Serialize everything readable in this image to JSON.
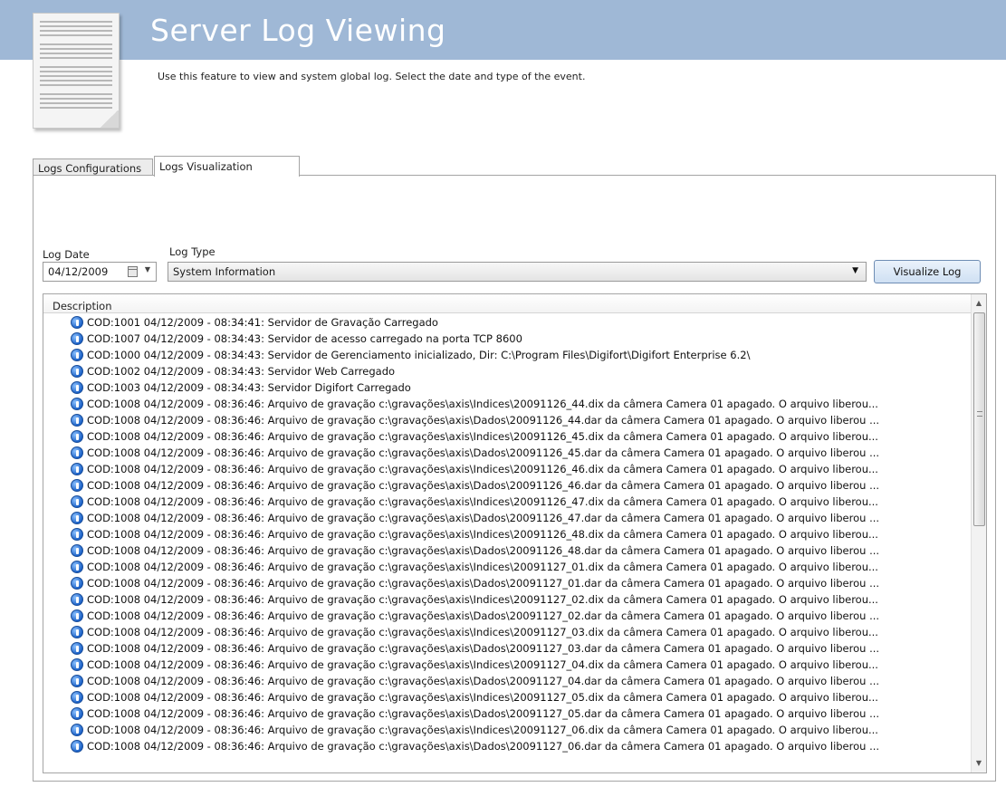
{
  "header": {
    "title": "Server Log Viewing",
    "description": "Use this feature to view and system global log. Select the date and type of the event."
  },
  "tabs": [
    {
      "label": "Logs Configurations",
      "active": false
    },
    {
      "label": "Logs Visualization",
      "active": true
    }
  ],
  "filters": {
    "date_label": "Log Date",
    "date_value": "04/12/2009",
    "type_label": "Log Type",
    "type_value": "System Information",
    "visualize_label": "Visualize Log"
  },
  "list": {
    "header": "Description",
    "icon": "info-icon",
    "rows": [
      "COD:1001 04/12/2009 - 08:34:41: Servidor de Gravação Carregado",
      "COD:1007 04/12/2009 - 08:34:43: Servidor de acesso carregado na porta TCP 8600",
      "COD:1000 04/12/2009 - 08:34:43: Servidor de Gerenciamento inicializado, Dir: C:\\Program Files\\Digifort\\Digifort Enterprise 6.2\\",
      "COD:1002 04/12/2009 - 08:34:43: Servidor Web Carregado",
      "COD:1003 04/12/2009 - 08:34:43: Servidor Digifort Carregado",
      "COD:1008 04/12/2009 - 08:36:46: Arquivo de gravação c:\\gravações\\axis\\Indices\\20091126_44.dix da câmera Camera 01 apagado. O arquivo liberou...",
      "COD:1008 04/12/2009 - 08:36:46: Arquivo de gravação c:\\gravações\\axis\\Dados\\20091126_44.dar da câmera Camera 01 apagado. O arquivo liberou ...",
      "COD:1008 04/12/2009 - 08:36:46: Arquivo de gravação c:\\gravações\\axis\\Indices\\20091126_45.dix da câmera Camera 01 apagado. O arquivo liberou...",
      "COD:1008 04/12/2009 - 08:36:46: Arquivo de gravação c:\\gravações\\axis\\Dados\\20091126_45.dar da câmera Camera 01 apagado. O arquivo liberou ...",
      "COD:1008 04/12/2009 - 08:36:46: Arquivo de gravação c:\\gravações\\axis\\Indices\\20091126_46.dix da câmera Camera 01 apagado. O arquivo liberou...",
      "COD:1008 04/12/2009 - 08:36:46: Arquivo de gravação c:\\gravações\\axis\\Dados\\20091126_46.dar da câmera Camera 01 apagado. O arquivo liberou ...",
      "COD:1008 04/12/2009 - 08:36:46: Arquivo de gravação c:\\gravações\\axis\\Indices\\20091126_47.dix da câmera Camera 01 apagado. O arquivo liberou...",
      "COD:1008 04/12/2009 - 08:36:46: Arquivo de gravação c:\\gravações\\axis\\Dados\\20091126_47.dar da câmera Camera 01 apagado. O arquivo liberou ...",
      "COD:1008 04/12/2009 - 08:36:46: Arquivo de gravação c:\\gravações\\axis\\Indices\\20091126_48.dix da câmera Camera 01 apagado. O arquivo liberou...",
      "COD:1008 04/12/2009 - 08:36:46: Arquivo de gravação c:\\gravações\\axis\\Dados\\20091126_48.dar da câmera Camera 01 apagado. O arquivo liberou ...",
      "COD:1008 04/12/2009 - 08:36:46: Arquivo de gravação c:\\gravações\\axis\\Indices\\20091127_01.dix da câmera Camera 01 apagado. O arquivo liberou...",
      "COD:1008 04/12/2009 - 08:36:46: Arquivo de gravação c:\\gravações\\axis\\Dados\\20091127_01.dar da câmera Camera 01 apagado. O arquivo liberou ...",
      "COD:1008 04/12/2009 - 08:36:46: Arquivo de gravação c:\\gravações\\axis\\Indices\\20091127_02.dix da câmera Camera 01 apagado. O arquivo liberou...",
      "COD:1008 04/12/2009 - 08:36:46: Arquivo de gravação c:\\gravações\\axis\\Dados\\20091127_02.dar da câmera Camera 01 apagado. O arquivo liberou ...",
      "COD:1008 04/12/2009 - 08:36:46: Arquivo de gravação c:\\gravações\\axis\\Indices\\20091127_03.dix da câmera Camera 01 apagado. O arquivo liberou...",
      "COD:1008 04/12/2009 - 08:36:46: Arquivo de gravação c:\\gravações\\axis\\Dados\\20091127_03.dar da câmera Camera 01 apagado. O arquivo liberou ...",
      "COD:1008 04/12/2009 - 08:36:46: Arquivo de gravação c:\\gravações\\axis\\Indices\\20091127_04.dix da câmera Camera 01 apagado. O arquivo liberou...",
      "COD:1008 04/12/2009 - 08:36:46: Arquivo de gravação c:\\gravações\\axis\\Dados\\20091127_04.dar da câmera Camera 01 apagado. O arquivo liberou ...",
      "COD:1008 04/12/2009 - 08:36:46: Arquivo de gravação c:\\gravações\\axis\\Indices\\20091127_05.dix da câmera Camera 01 apagado. O arquivo liberou...",
      "COD:1008 04/12/2009 - 08:36:46: Arquivo de gravação c:\\gravações\\axis\\Dados\\20091127_05.dar da câmera Camera 01 apagado. O arquivo liberou ...",
      "COD:1008 04/12/2009 - 08:36:46: Arquivo de gravação c:\\gravações\\axis\\Indices\\20091127_06.dix da câmera Camera 01 apagado. O arquivo liberou...",
      "COD:1008 04/12/2009 - 08:36:46: Arquivo de gravação c:\\gravações\\axis\\Dados\\20091127_06.dar da câmera Camera 01 apagado. O arquivo liberou ..."
    ]
  }
}
